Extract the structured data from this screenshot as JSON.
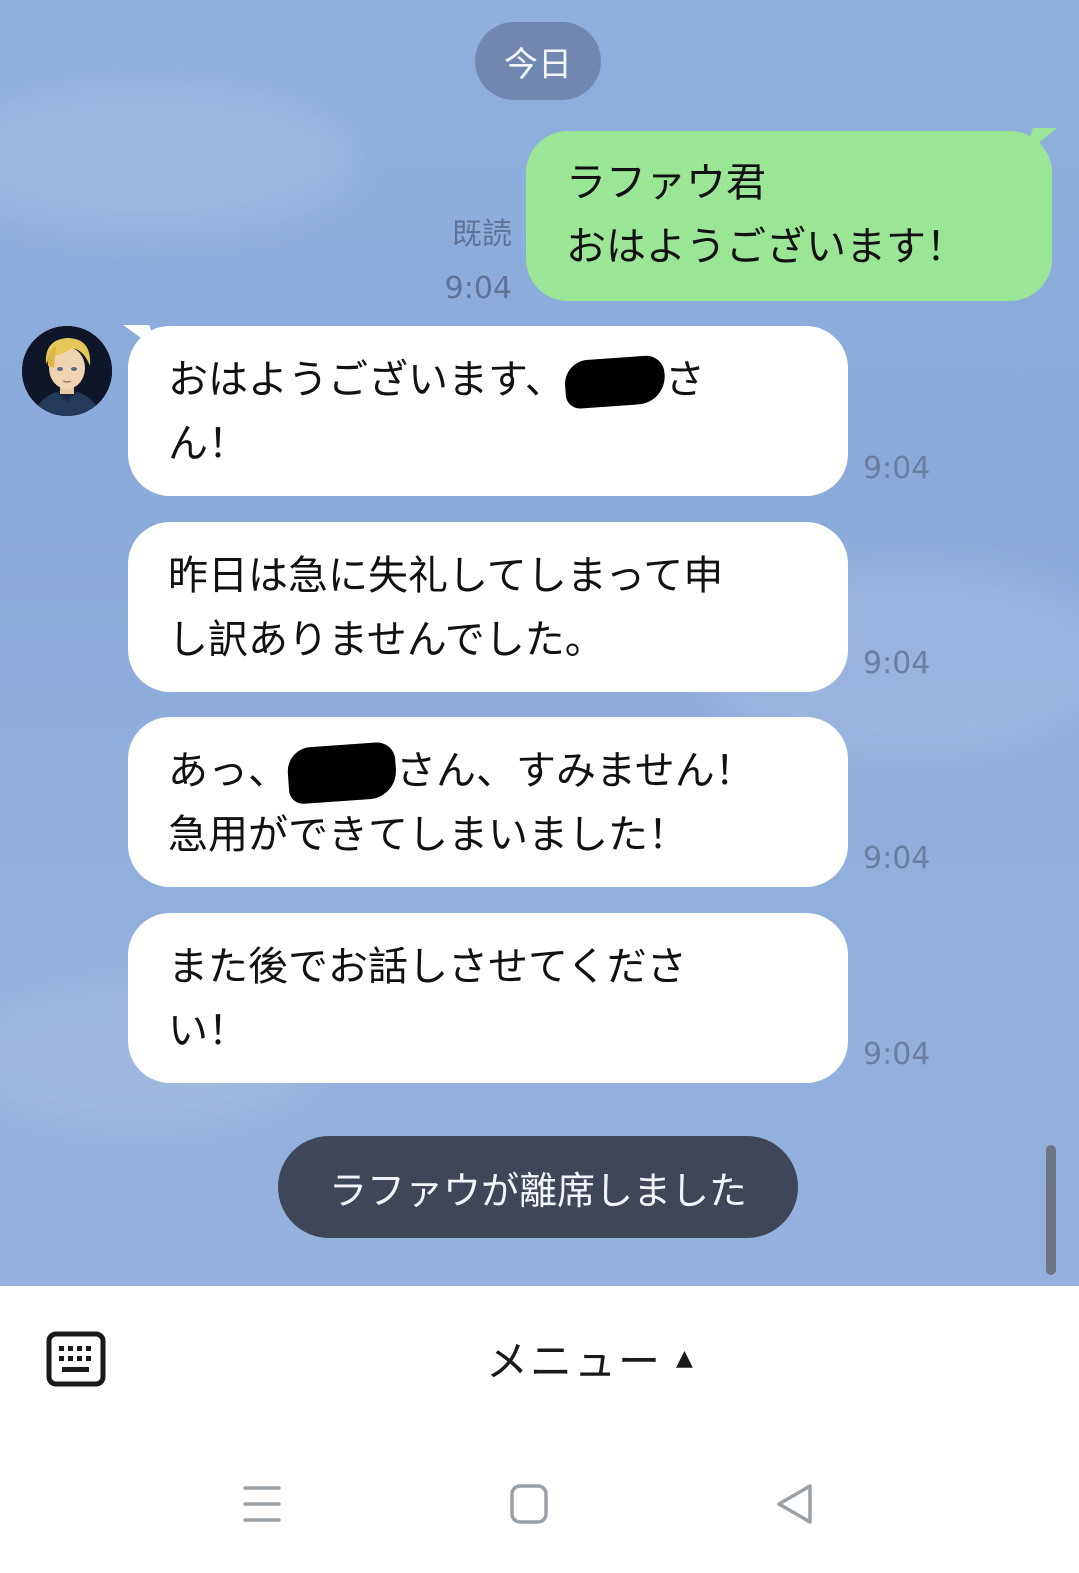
{
  "date_label": "今日",
  "sent": {
    "lines": [
      "ラファウ君",
      "おはようございます！"
    ],
    "read_label": "既読",
    "time": "9:04"
  },
  "received": [
    {
      "lines": [
        "おはようございます、",
        "ん！"
      ],
      "suffix": "さ",
      "time": "9:04"
    },
    {
      "lines": [
        "昨日は急に失礼してしまって申",
        "し訳ありませんでした。"
      ],
      "time": "9:04"
    },
    {
      "prefix": "あっ、",
      "lines": [
        "さん、すみません！",
        "急用ができてしまいました！"
      ],
      "time": "9:04"
    },
    {
      "lines": [
        "また後でお話しさせてくださ",
        "い！"
      ],
      "time": "9:04"
    }
  ],
  "system_notice": "ラファウが離席しました",
  "bottom_bar": {
    "keyboard_icon": "keyboard-icon",
    "menu_label": "メニュー",
    "menu_arrow": "▲"
  },
  "nav_bar": {
    "icons": [
      "recent-apps-icon",
      "home-icon",
      "back-icon"
    ]
  },
  "colors": {
    "chat_background": "#8fb0dc",
    "sent_bubble": "#9be596",
    "received_bubble": "#ffffff",
    "notice_pill": "#3f4657"
  }
}
